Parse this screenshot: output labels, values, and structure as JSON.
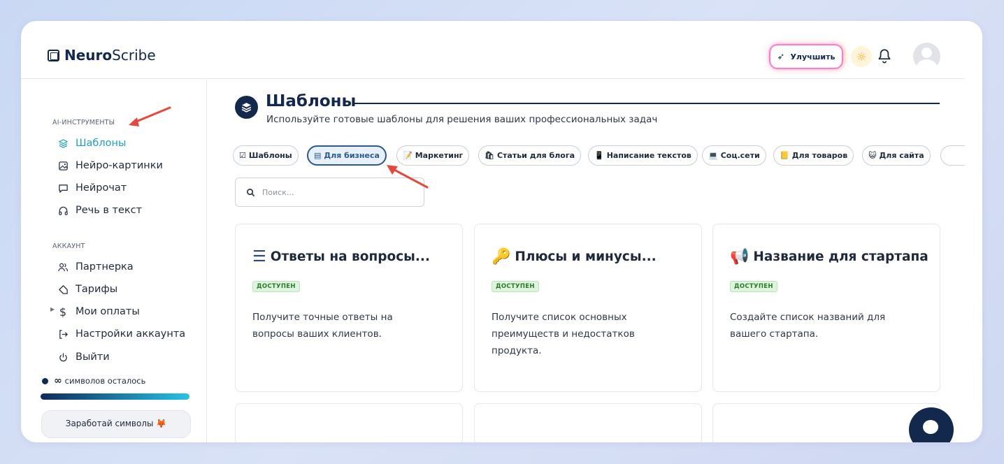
{
  "header": {
    "logo_bold": "Neuro",
    "logo_light": "Scribe",
    "upgrade_label": "Улучшить"
  },
  "sidebar": {
    "section_tools": "AI-ИНСТРУМЕНТЫ",
    "tools": [
      {
        "label": "Шаблоны",
        "icon": "layers-icon",
        "active": true
      },
      {
        "label": "Нейро-картинки",
        "icon": "image-icon"
      },
      {
        "label": "Нейрочат",
        "icon": "chat-icon"
      },
      {
        "label": "Речь в текст",
        "icon": "headphones-icon"
      }
    ],
    "section_account": "АККАУНТ",
    "account": [
      {
        "label": "Партнерка",
        "icon": "users-icon"
      },
      {
        "label": "Тарифы",
        "icon": "tag-icon"
      },
      {
        "label": "Мои оплаты",
        "icon": "dollar-icon"
      },
      {
        "label": "Настройки аккаунта",
        "icon": "sign-in-icon"
      },
      {
        "label": "Выйти",
        "icon": "power-icon"
      }
    ],
    "chars_symbol": "∞",
    "chars_text": "символов осталось",
    "earn_label": "Заработай символы 🦊"
  },
  "main": {
    "title": "Шаблоны",
    "subtitle": "Используйте готовые шаблоны для решения ваших профессиональных задач",
    "tabs": [
      {
        "icon": "☑",
        "label": "Шаблоны"
      },
      {
        "icon": "▤",
        "label": "Для бизнеса",
        "active": true
      },
      {
        "icon": "📝",
        "label": "Маркетинг"
      },
      {
        "icon": "🛍",
        "label": "Статьи для блога"
      },
      {
        "icon": "📱",
        "label": "Написание текстов"
      },
      {
        "icon": "💻",
        "label": "Соц.сети"
      },
      {
        "icon": "📒",
        "label": "Для товаров"
      },
      {
        "icon": "😺",
        "label": "Для сайта"
      }
    ],
    "search_placeholder": "Поиск...",
    "cards": [
      {
        "emoji": "☰",
        "title": "Ответы на вопросы...",
        "badge": "ДОСТУПЕН",
        "desc": "Получите точные ответы на вопросы ваших клиентов."
      },
      {
        "emoji": "🔑",
        "title": "Плюсы и минусы...",
        "badge": "ДОСТУПЕН",
        "desc": "Получите список основных преимуществ и недостатков продукта."
      },
      {
        "emoji": "📢",
        "title": "Название для стартапа",
        "badge": "ДОСТУПЕН",
        "desc": "Создайте список названий для вашего стартапа."
      }
    ]
  },
  "colors": {
    "accent": "#1aa0c8",
    "navy": "#12284d",
    "badge_bg": "#dcf5dc",
    "arrow": "#e8473c"
  }
}
